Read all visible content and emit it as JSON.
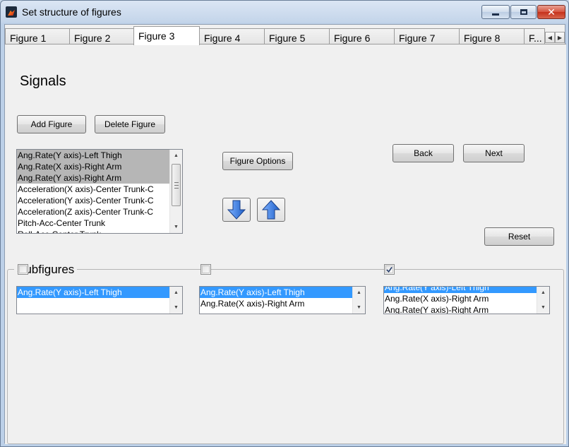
{
  "window": {
    "title": "Set structure of figures",
    "close_glyph": "✕"
  },
  "tabs": [
    {
      "label": "Figure 1"
    },
    {
      "label": "Figure 2"
    },
    {
      "label": "Figure 3"
    },
    {
      "label": "Figure 4"
    },
    {
      "label": "Figure 5"
    },
    {
      "label": "Figure 6"
    },
    {
      "label": "Figure 7"
    },
    {
      "label": "Figure 8"
    },
    {
      "label": "F..."
    }
  ],
  "active_tab": "Figure 3",
  "signals": {
    "heading": "Signals",
    "add_figure_label": "Add Figure",
    "delete_figure_label": "Delete Figure",
    "figure_options_label": "Figure Options",
    "back_label": "Back",
    "next_label": "Next",
    "reset_label": "Reset",
    "move_down_icon": "arrow-down-icon",
    "move_up_icon": "arrow-up-icon",
    "list": [
      "Ang.Rate(Y axis)-Left Thigh",
      "Ang.Rate(X axis)-Right Arm",
      "Ang.Rate(Y axis)-Right Arm",
      "Acceleration(X axis)-Center Trunk-C",
      "Acceleration(Y axis)-Center Trunk-C",
      "Acceleration(Z axis)-Center Trunk-C",
      "Pitch-Acc-Center Trunk",
      "Roll-Acc-Center Trunk"
    ],
    "selected_count": 3
  },
  "subfigures": {
    "label": "Subfigures",
    "panels": [
      {
        "checked": false,
        "items": [
          "Ang.Rate(Y axis)-Left Thigh"
        ],
        "selected": [
          0
        ]
      },
      {
        "checked": false,
        "items": [
          "Ang.Rate(Y axis)-Left Thigh",
          "Ang.Rate(X axis)-Right Arm"
        ],
        "selected": [
          0
        ]
      },
      {
        "checked": true,
        "items": [
          "Ang.Rate(Y axis)-Left Thigh",
          "Ang.Rate(X axis)-Right Arm",
          "Ang.Rate(Y axis)-Right Arm"
        ],
        "selected": [
          0
        ]
      }
    ]
  },
  "colors": {
    "selection_blue": "#3399ff",
    "selection_gray": "#b6b6b6",
    "arrow_blue": "#2f72d6"
  }
}
